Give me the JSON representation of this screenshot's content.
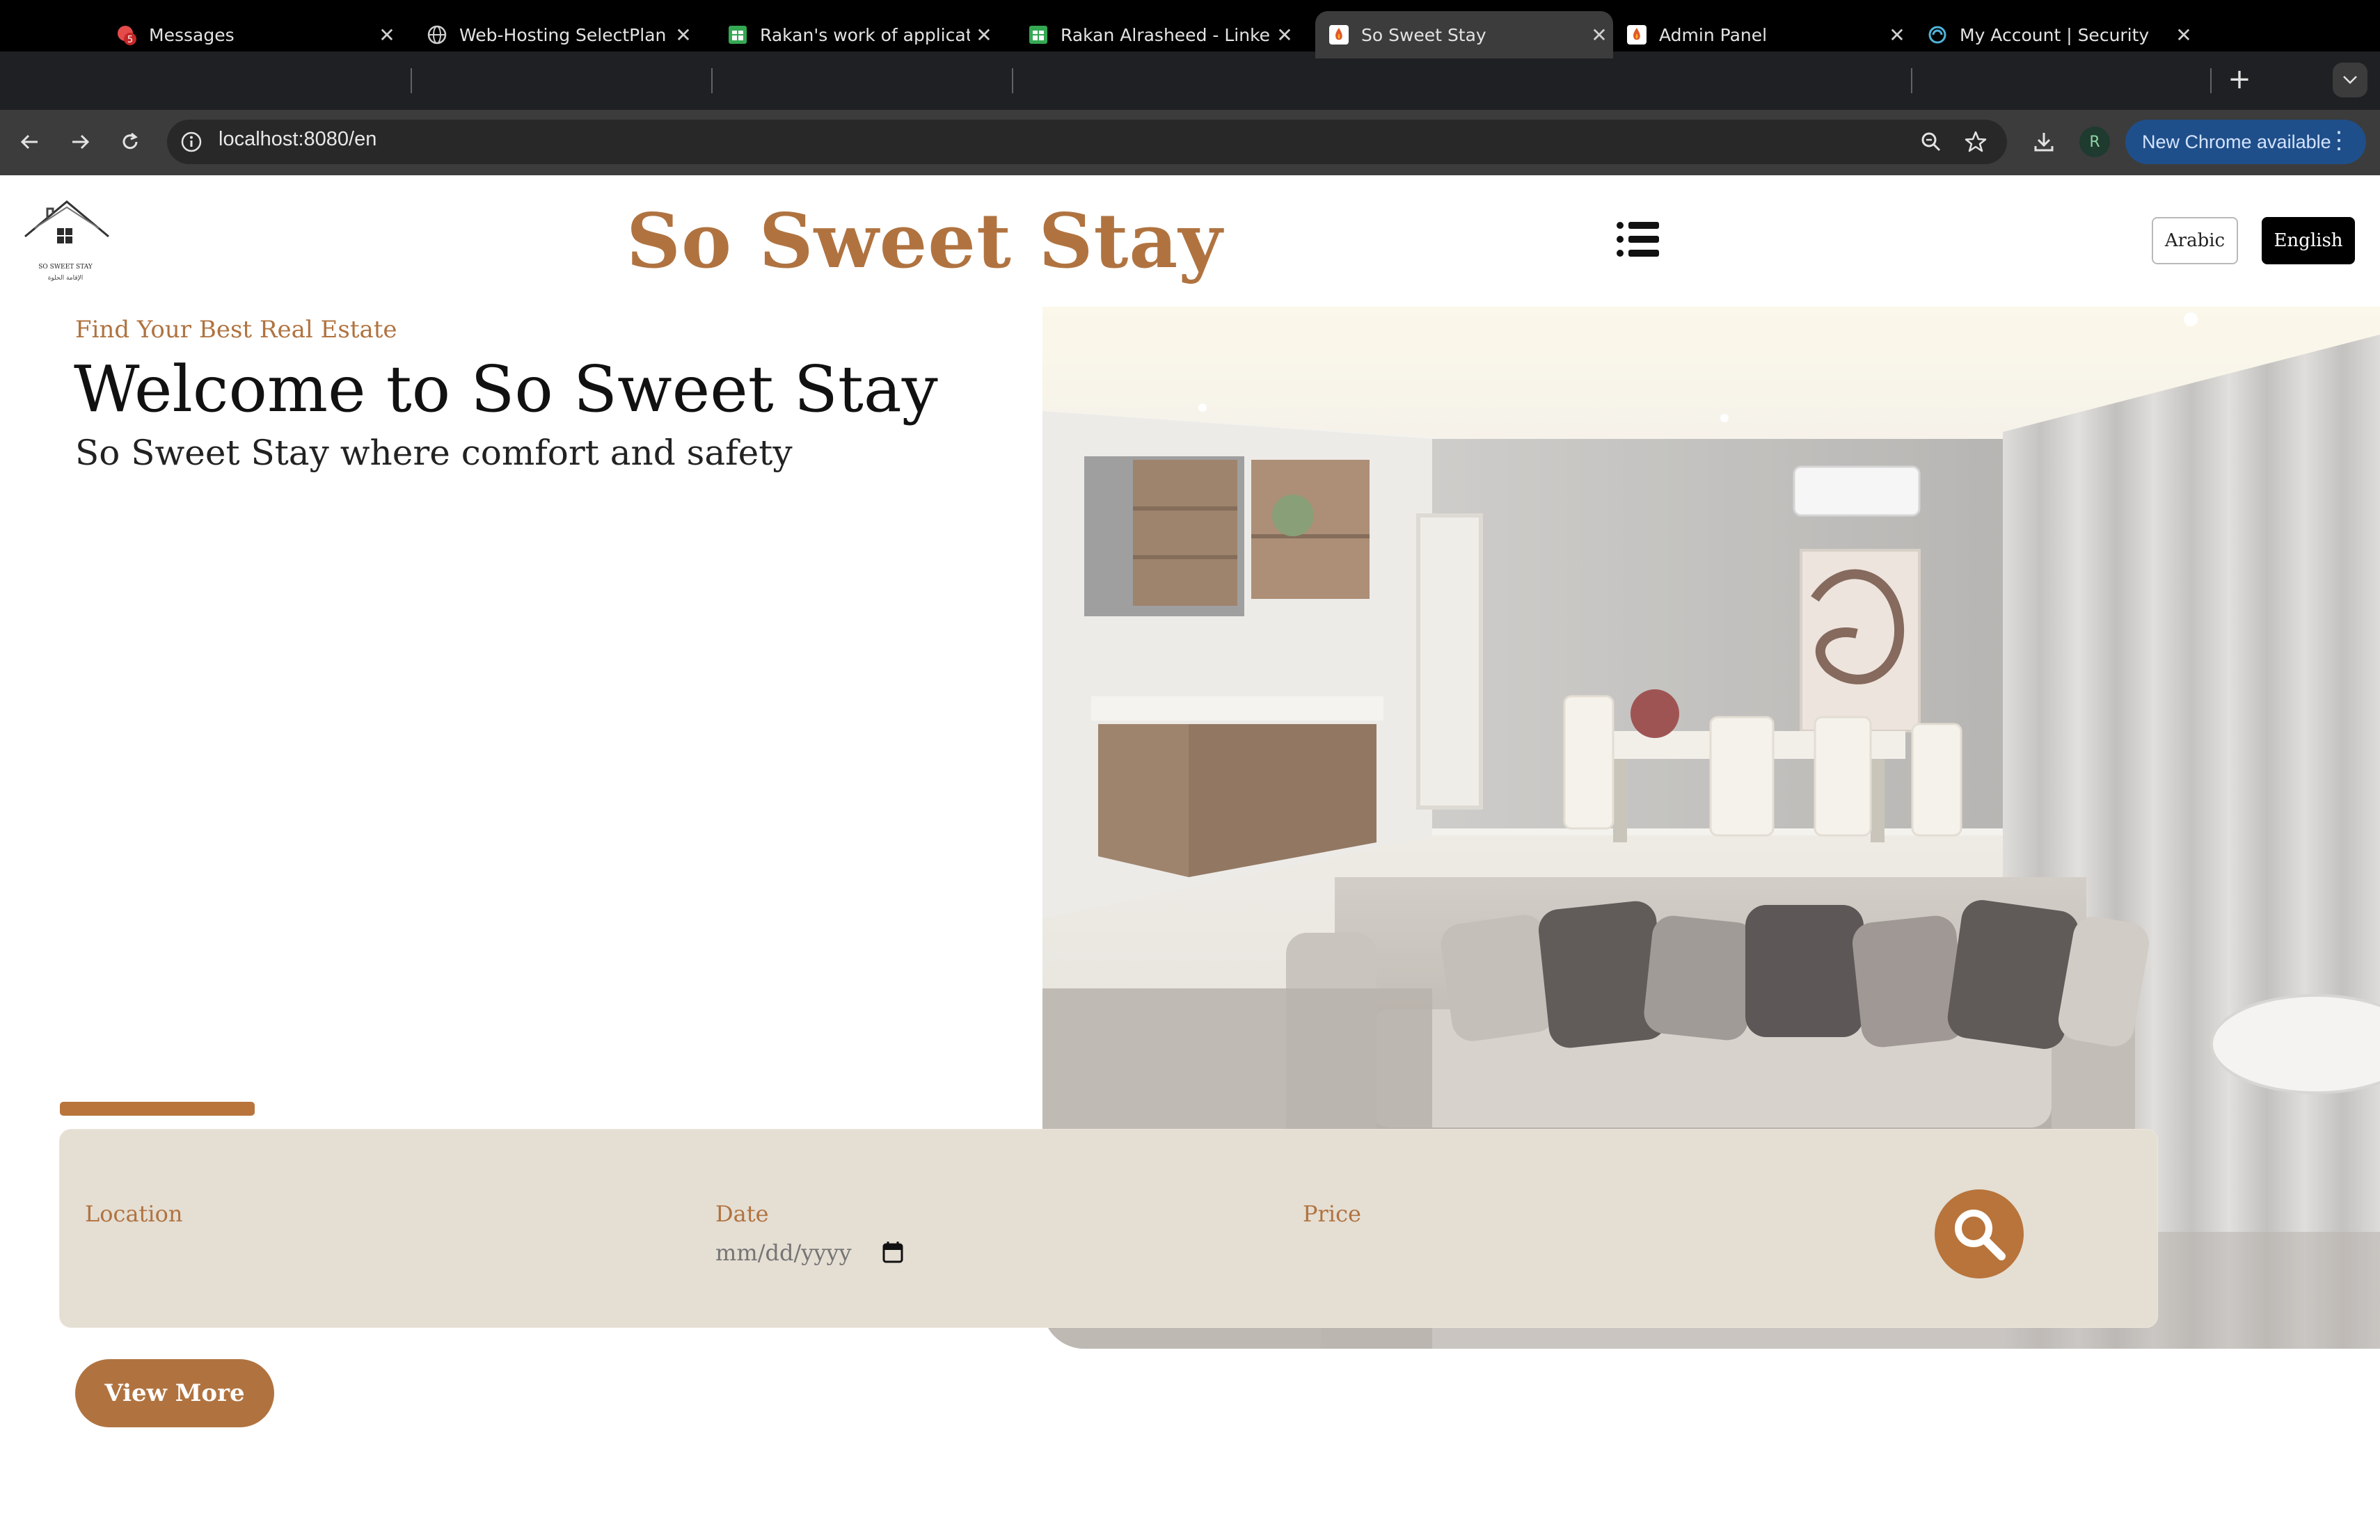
{
  "browser": {
    "tabs": [
      {
        "title": "Messages",
        "icon": "messages-icon",
        "badge": "5"
      },
      {
        "title": "Web-Hosting SelectPlan",
        "icon": "globe-icon"
      },
      {
        "title": "Rakan's work of applicatio",
        "icon": "sheets-icon"
      },
      {
        "title": "Rakan Alrasheed - Linked",
        "icon": "sheets-icon"
      },
      {
        "title": "So Sweet Stay",
        "icon": "site-favicon",
        "active": true
      },
      {
        "title": "Admin Panel",
        "icon": "site-favicon"
      },
      {
        "title": "My Account | Security",
        "icon": "account-icon"
      }
    ],
    "address": "localhost:8080/en",
    "profile_initial": "R",
    "update_label": "New Chrome available"
  },
  "header": {
    "logo_text": "SO SWEET STAY",
    "logo_text_arabic": "الإقامة الحلوة",
    "site_title": "So Sweet Stay",
    "lang_arabic": "Arabic",
    "lang_english": "English"
  },
  "hero": {
    "kicker": "Find Your Best Real Estate",
    "title": "Welcome to So Sweet Stay",
    "subtitle": "So Sweet Stay where comfort and safety"
  },
  "search": {
    "location_label": "Location",
    "date_label": "Date",
    "date_placeholder": "mm/dd/yyyy",
    "price_label": "Price"
  },
  "cta": {
    "view_more": "View More"
  },
  "colors": {
    "brand": "#b07340",
    "panel": "#e5ded3",
    "chrome_dark": "#1f2023"
  }
}
